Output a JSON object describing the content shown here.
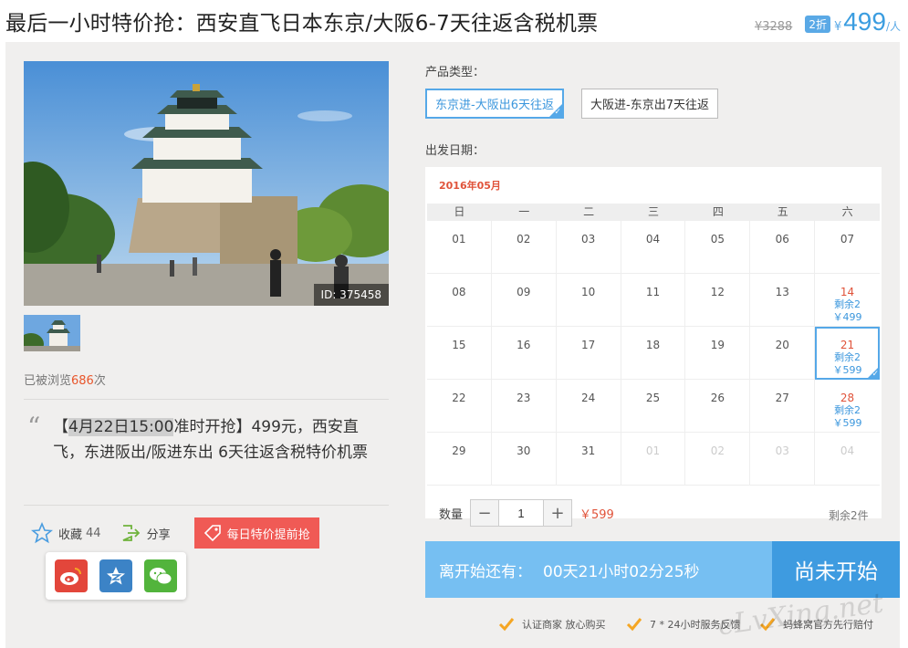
{
  "header": {
    "title": "最后一小时特价抢：西安直飞日本东京/大阪6-7天往返含税机票",
    "original_price": "¥3288",
    "discount": "2折",
    "currency": "¥",
    "price": "499",
    "per_person": "/人"
  },
  "gallery": {
    "photo_id": "ID: 375458"
  },
  "views": {
    "prefix": "已被浏览",
    "count": "686",
    "suffix": "次"
  },
  "description": {
    "quote": "“",
    "bracket_open": "【",
    "highlight": "4月22日15:00",
    "after_highlight": "准时开抢】499元，西安直飞，东进阪出/阪进东出 6天往返含税特价机票"
  },
  "actions": {
    "favorite_label": "收藏",
    "favorite_count": "44",
    "share_label": "分享",
    "promo_label": "每日特价提前抢"
  },
  "product": {
    "type_label": "产品类型：",
    "types": [
      "东京进-大阪出6天往返",
      "大阪进-东京出7天往返"
    ],
    "selected_type": 0
  },
  "calendar": {
    "date_label": "出发日期：",
    "month": "2016年05月",
    "weekdays": [
      "日",
      "一",
      "二",
      "三",
      "四",
      "五",
      "六"
    ],
    "weeks": [
      [
        {
          "d": "01"
        },
        {
          "d": "02"
        },
        {
          "d": "03"
        },
        {
          "d": "04"
        },
        {
          "d": "05"
        },
        {
          "d": "06"
        },
        {
          "d": "07"
        }
      ],
      [
        {
          "d": "08"
        },
        {
          "d": "09"
        },
        {
          "d": "10"
        },
        {
          "d": "11"
        },
        {
          "d": "12"
        },
        {
          "d": "13"
        },
        {
          "d": "14",
          "rem": "剩余2",
          "price": "￥499"
        }
      ],
      [
        {
          "d": "15"
        },
        {
          "d": "16"
        },
        {
          "d": "17"
        },
        {
          "d": "18"
        },
        {
          "d": "19"
        },
        {
          "d": "20"
        },
        {
          "d": "21",
          "rem": "剩余2",
          "price": "￥599",
          "selected": true
        }
      ],
      [
        {
          "d": "22"
        },
        {
          "d": "23"
        },
        {
          "d": "24"
        },
        {
          "d": "25"
        },
        {
          "d": "26"
        },
        {
          "d": "27"
        },
        {
          "d": "28",
          "rem": "剩余2",
          "price": "￥599"
        }
      ],
      [
        {
          "d": "29"
        },
        {
          "d": "30"
        },
        {
          "d": "31"
        },
        {
          "d": "01",
          "other": true
        },
        {
          "d": "02",
          "other": true
        },
        {
          "d": "03",
          "other": true
        },
        {
          "d": "04",
          "other": true
        }
      ]
    ]
  },
  "quantity": {
    "label": "数量",
    "minus": "−",
    "value": "1",
    "plus": "+",
    "total": "￥599",
    "stock": "剩余2件"
  },
  "countdown": {
    "label": "离开始还有：",
    "time": "00天21小时02分25秒",
    "button": "尚未开始"
  },
  "guarantees": [
    "认证商家 放心购买",
    "7 * 24小时服务反馈",
    "蚂蜂窝官方先行赔付"
  ],
  "watermark": "eLvXing.net",
  "colors": {
    "accent_blue": "#3e9be0",
    "accent_red": "#f05a55",
    "countdown_bg": "#76bff2"
  }
}
